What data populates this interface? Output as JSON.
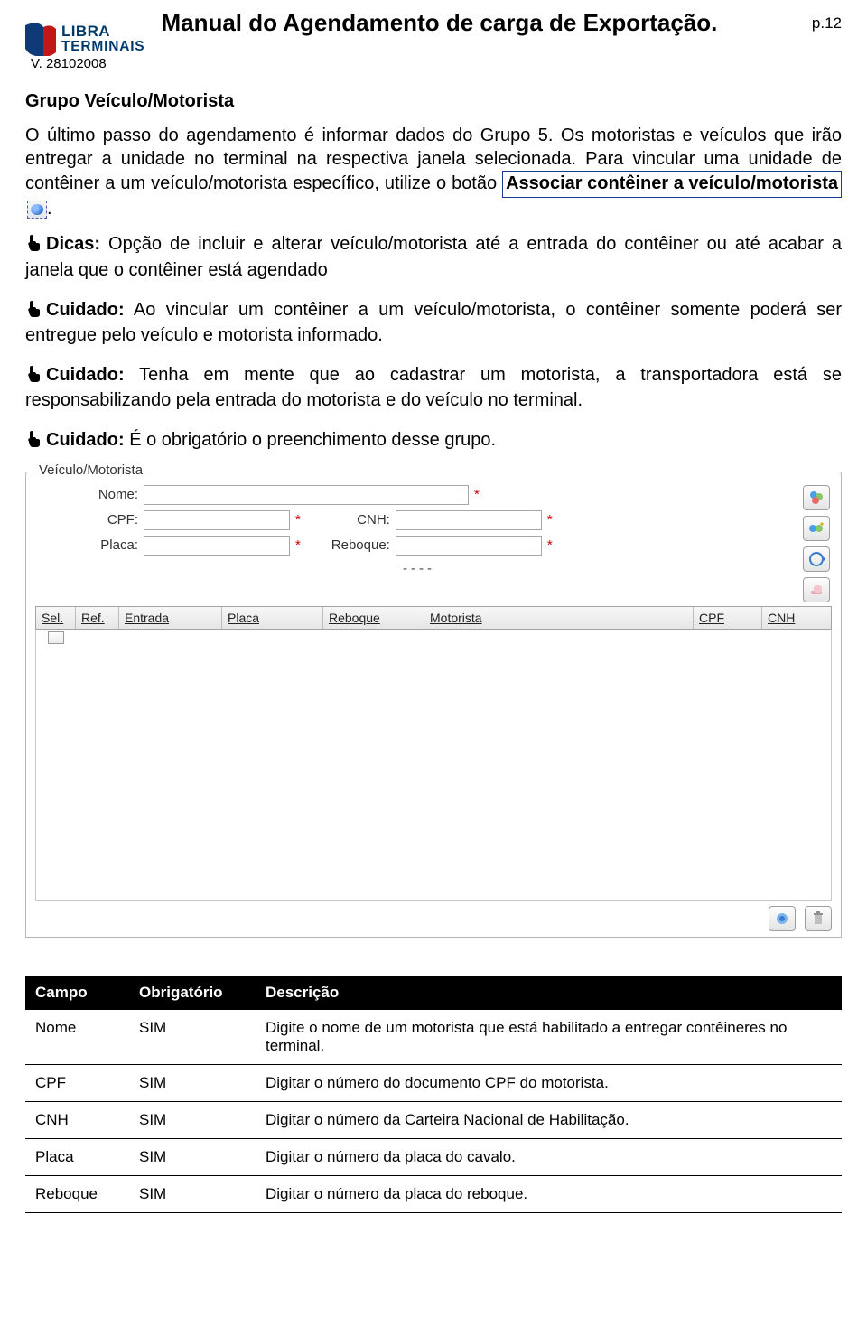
{
  "header": {
    "logo_line1": "LIBRA",
    "logo_line2": "TERMINAIS",
    "title": "Manual do Agendamento de carga de Exportação.",
    "page_label": "p.12",
    "version": "V. 28102008"
  },
  "section": {
    "heading": "Grupo Veículo/Motorista",
    "para1_a": "O último passo do agendamento é informar dados do Grupo 5. Os motoristas e veículos que irão entregar a unidade no terminal na respectiva janela selecionada. Para vincular uma unidade de contêiner a um veículo/motorista específico, utilize o botão ",
    "para1_link": "Associar contêiner a veículo/motorista",
    "para1_b": "."
  },
  "notes": {
    "dicas_label": "Dicas:",
    "dicas_text": " Opção de incluir e alterar veículo/motorista até a entrada do contêiner ou até acabar a janela que o contêiner está agendado",
    "cuidado_label": "Cuidado:",
    "cuidado1": " Ao vincular um contêiner a um veículo/motorista, o contêiner somente poderá ser entregue pelo veículo e motorista informado.",
    "cuidado2": " Tenha em mente que ao cadastrar um motorista, a transportadora está se responsabilizando pela entrada do motorista e do veículo no terminal.",
    "cuidado3": " É o obrigatório o preenchimento desse grupo."
  },
  "panel": {
    "legend": "Veículo/Motorista",
    "labels": {
      "nome": "Nome:",
      "cpf": "CPF:",
      "cnh": "CNH:",
      "placa": "Placa:",
      "reboque": "Reboque:"
    },
    "asterisk": "*",
    "dashes": "----",
    "grid_headers": [
      "Sel.",
      "Ref.",
      "Entrada",
      "Placa",
      "Reboque",
      "Motorista",
      "CPF",
      "CNH"
    ]
  },
  "table": {
    "headers": [
      "Campo",
      "Obrigatório",
      "Descrição"
    ],
    "rows": [
      {
        "campo": "Nome",
        "obr": "SIM",
        "desc": "Digite o nome de um motorista que está habilitado a entregar contêineres no terminal."
      },
      {
        "campo": "CPF",
        "obr": "SIM",
        "desc": "Digitar o número do documento CPF do motorista."
      },
      {
        "campo": "CNH",
        "obr": "SIM",
        "desc": "Digitar o número da Carteira Nacional de Habilitação."
      },
      {
        "campo": "Placa",
        "obr": "SIM",
        "desc": "Digitar o número da placa do cavalo."
      },
      {
        "campo": "Reboque",
        "obr": "SIM",
        "desc": "Digitar o número da placa do reboque."
      }
    ]
  }
}
